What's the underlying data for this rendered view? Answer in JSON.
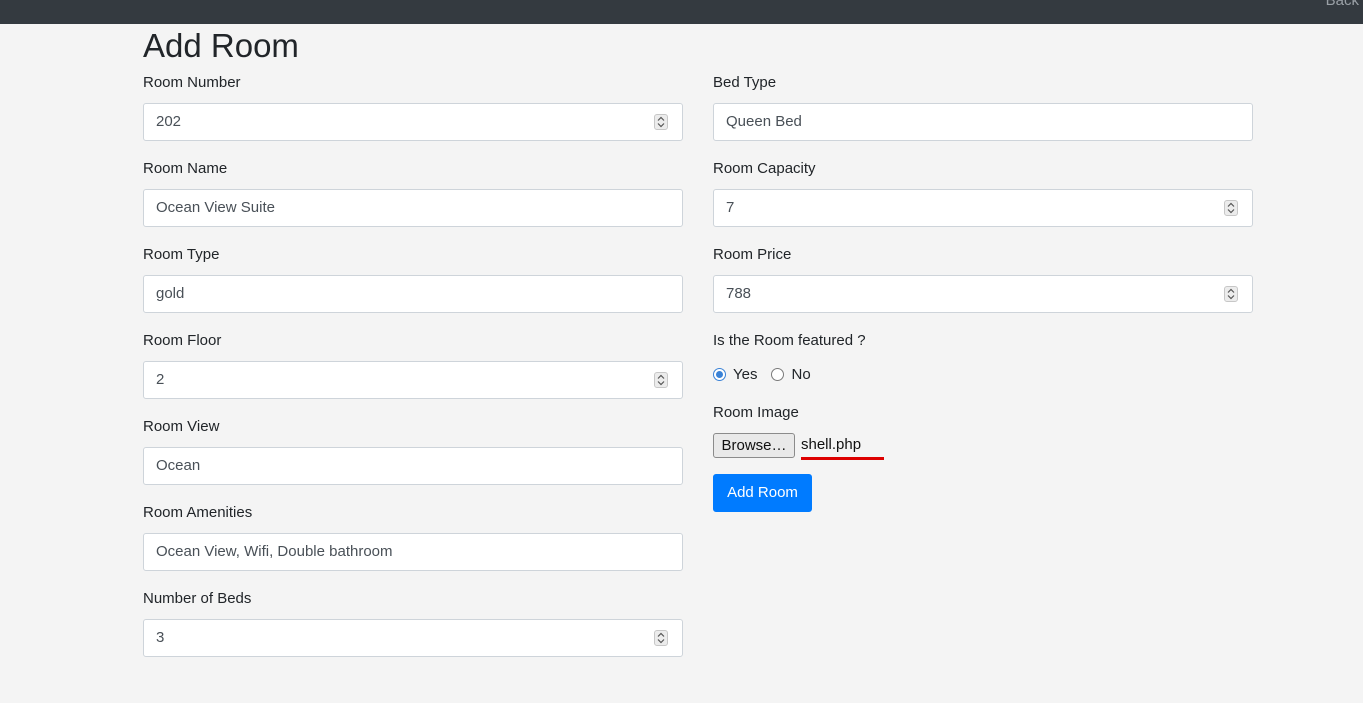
{
  "topbar": {
    "link_label": "Back"
  },
  "page": {
    "title": "Add Room"
  },
  "form": {
    "room_number": {
      "label": "Room Number",
      "value": "202"
    },
    "room_name": {
      "label": "Room Name",
      "value": "Ocean View Suite"
    },
    "room_type": {
      "label": "Room Type",
      "value": "gold"
    },
    "room_floor": {
      "label": "Room Floor",
      "value": "2"
    },
    "room_view": {
      "label": "Room View",
      "value": "Ocean"
    },
    "room_amenities": {
      "label": "Room Amenities",
      "value": "Ocean View, Wifi, Double bathroom"
    },
    "number_of_beds": {
      "label": "Number of Beds",
      "value": "3"
    },
    "bed_type": {
      "label": "Bed Type",
      "value": "Queen Bed"
    },
    "room_capacity": {
      "label": "Room Capacity",
      "value": "7"
    },
    "room_price": {
      "label": "Room Price",
      "value": "788"
    },
    "featured": {
      "label": "Is the Room featured ?",
      "options": [
        "Yes",
        "No"
      ],
      "selected": "Yes"
    },
    "room_image": {
      "label": "Room Image",
      "browse_label": "Browse…",
      "file_name": "shell.php"
    },
    "submit_label": "Add Room"
  },
  "colors": {
    "topbar": "#343a40",
    "background": "#f4f4f4",
    "primary": "#007bff",
    "highlight_underline": "#dd0000"
  },
  "icons": {
    "stepper": "stepper-arrows-icon"
  }
}
